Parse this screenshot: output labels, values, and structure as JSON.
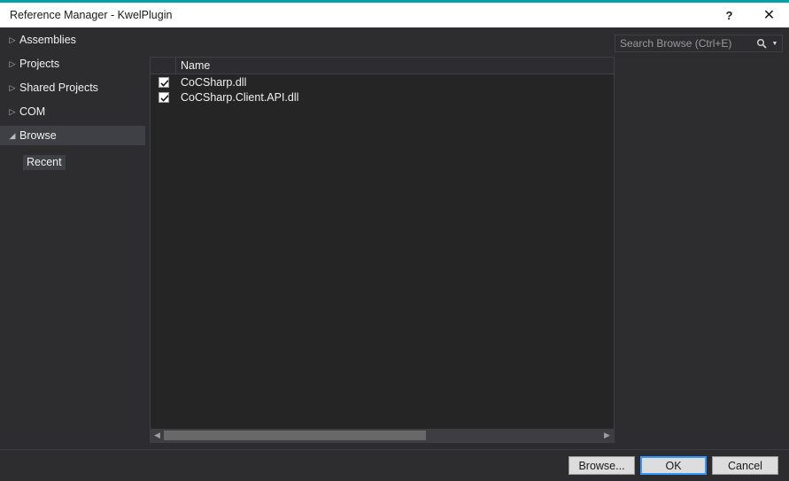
{
  "window": {
    "title": "Reference Manager - KwelPlugin",
    "accent_color": "#00a2ad",
    "help_icon": "?",
    "close_icon": "✕"
  },
  "sidebar": {
    "items": [
      {
        "label": "Assemblies",
        "arrow": "▷",
        "expanded": false,
        "selected": false
      },
      {
        "label": "Projects",
        "arrow": "▷",
        "expanded": false,
        "selected": false
      },
      {
        "label": "Shared Projects",
        "arrow": "▷",
        "expanded": false,
        "selected": false
      },
      {
        "label": "COM",
        "arrow": "▷",
        "expanded": false,
        "selected": false
      },
      {
        "label": "Browse",
        "arrow": "◢",
        "expanded": true,
        "selected": true
      },
      {
        "label": "Recent",
        "arrow": "",
        "expanded": false,
        "selected": false
      }
    ]
  },
  "search": {
    "placeholder": "Search Browse (Ctrl+E)",
    "value": "",
    "icon": "search-icon",
    "dropdown_icon": "▼"
  },
  "list": {
    "columns": [
      "",
      "Name"
    ],
    "rows": [
      {
        "checked": true,
        "name": "CoCSharp.dll"
      },
      {
        "checked": true,
        "name": "CoCSharp.Client.API.dll"
      }
    ],
    "scrollbar": {
      "left_arrow": "◀",
      "right_arrow": "▶",
      "thumb_percent": 60
    }
  },
  "footer": {
    "browse_label": "Browse...",
    "ok_label": "OK",
    "cancel_label": "Cancel",
    "focus_color": "#3399ff"
  }
}
